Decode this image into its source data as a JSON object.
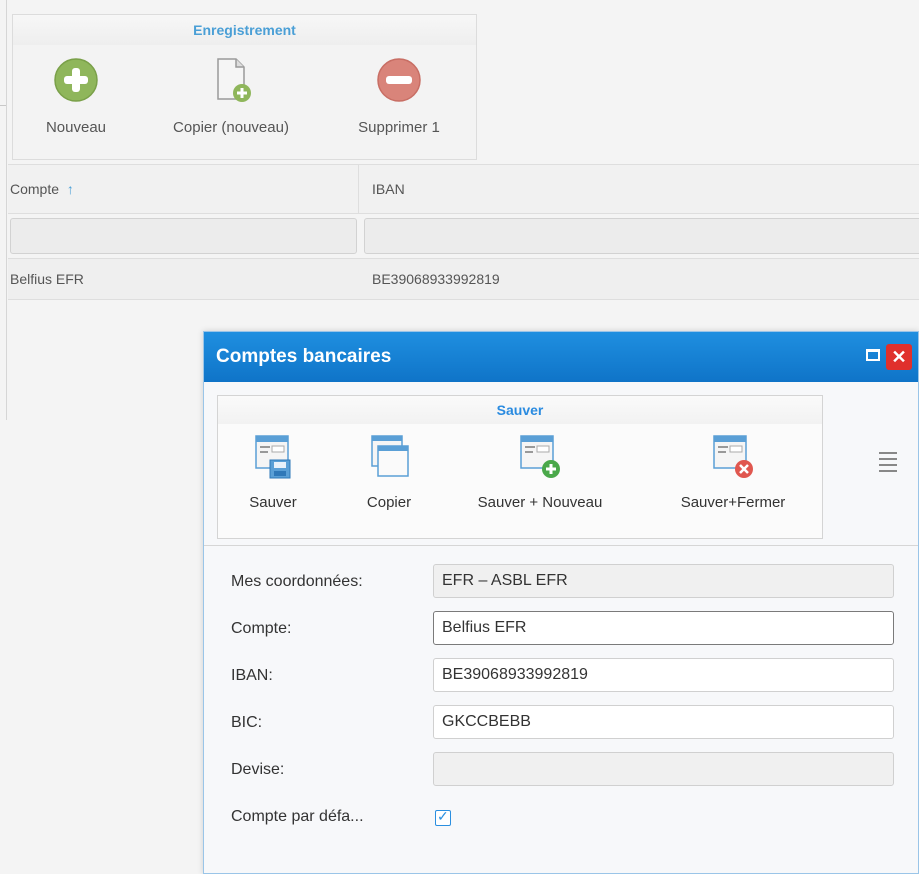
{
  "ribbon": {
    "group_title": "Enregistrement",
    "new_label": "Nouveau",
    "copy_new_label": "Copier (nouveau)",
    "delete_label": "Supprimer 1"
  },
  "grid": {
    "columns": [
      {
        "label": "Compte",
        "sort": "↑"
      },
      {
        "label": "IBAN"
      }
    ],
    "rows": [
      {
        "compte": "Belfius EFR",
        "iban": "BE39068933992819"
      }
    ]
  },
  "dialog": {
    "title": "Comptes bancaires",
    "close_glyph": "✕",
    "ribbon": {
      "group_title": "Sauver",
      "save_label": "Sauver",
      "copy_label": "Copier",
      "save_new_label": "Sauver + Nouveau",
      "save_close_label": "Sauver+Fermer"
    },
    "form": {
      "coords_label": "Mes coordonnées:",
      "coords_value": "EFR – ASBL EFR",
      "compte_label": "Compte:",
      "compte_value": "Belfius EFR",
      "iban_label": "IBAN:",
      "iban_value": "BE39068933992819",
      "bic_label": "BIC:",
      "bic_value": "GKCCBEBB",
      "devise_label": "Devise:",
      "devise_value": "",
      "default_label": "Compte par défa...",
      "default_checked": true,
      "checkmark": "✓"
    }
  },
  "colors": {
    "accent": "#1f8fe0",
    "new_icon": "#8fb65b",
    "delete_icon": "#d9847a",
    "close_button": "#e0302c"
  }
}
